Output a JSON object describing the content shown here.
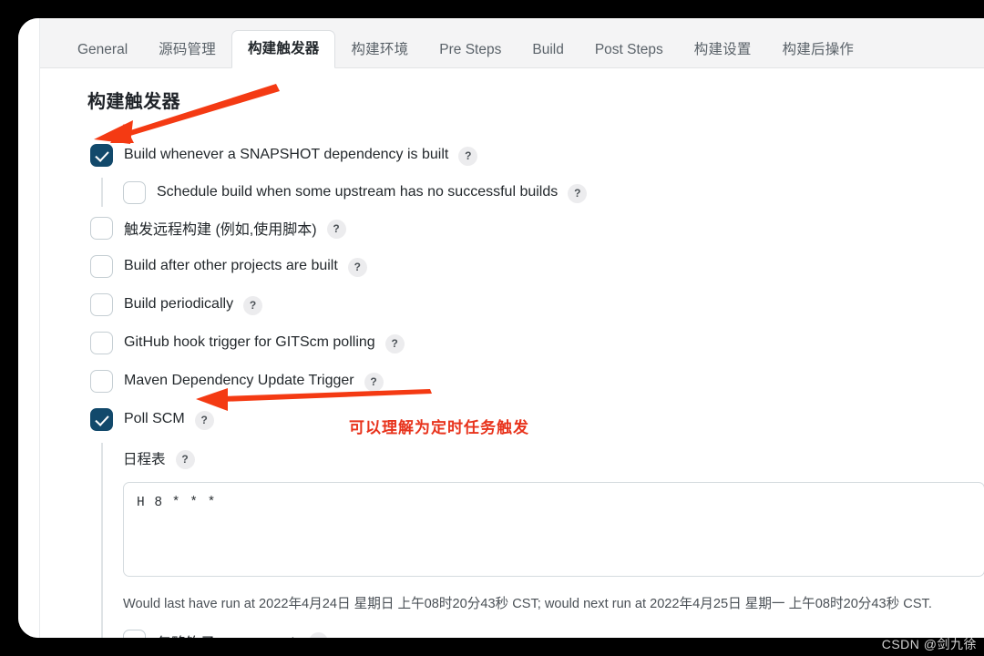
{
  "window": {
    "background_color": "#000000",
    "card_color": "#ffffff"
  },
  "tabs": [
    {
      "label": "General",
      "active": false
    },
    {
      "label": "源码管理",
      "active": false
    },
    {
      "label": "构建触发器",
      "active": true
    },
    {
      "label": "构建环境",
      "active": false
    },
    {
      "label": "Pre Steps",
      "active": false
    },
    {
      "label": "Build",
      "active": false
    },
    {
      "label": "Post Steps",
      "active": false
    },
    {
      "label": "构建设置",
      "active": false
    },
    {
      "label": "构建后操作",
      "active": false
    }
  ],
  "section": {
    "title": "构建触发器"
  },
  "triggers": [
    {
      "label": "Build whenever a SNAPSHOT dependency is built",
      "checked": true,
      "help": "?"
    },
    {
      "label": "Schedule build when some upstream has no successful builds",
      "checked": false,
      "help": "?"
    },
    {
      "label": "触发远程构建 (例如,使用脚本)",
      "checked": false,
      "help": "?"
    },
    {
      "label": "Build after other projects are built",
      "checked": false,
      "help": "?"
    },
    {
      "label": "Build periodically",
      "checked": false,
      "help": "?"
    },
    {
      "label": "GitHub hook trigger for GITScm polling",
      "checked": false,
      "help": "?"
    },
    {
      "label": "Maven Dependency Update Trigger",
      "checked": false,
      "help": "?"
    },
    {
      "label": "Poll SCM",
      "checked": true,
      "help": "?"
    }
  ],
  "schedule": {
    "label": "日程表",
    "help": "?",
    "cron_value": "H 8 * * *",
    "cron_placeholder": "",
    "note": "Would last have run at 2022年4月24日 星期日 上午08时20分43秒 CST; would next run at 2022年4月25日 星期一 上午08时20分43秒 CST.",
    "ignore_post_commit": {
      "label": "忽略钩子 post-commit",
      "checked": false,
      "help": "?"
    }
  },
  "annotations": {
    "arrow_color": "#f43a13",
    "note_text": "可以理解为定时任务触发",
    "note_color": "#e8331c"
  },
  "watermark": {
    "text": "CSDN @剑九徐"
  },
  "colors": {
    "checkbox_checked": "#12496b",
    "tabbar_bg": "#f4f4f5",
    "text": "#23282c"
  }
}
